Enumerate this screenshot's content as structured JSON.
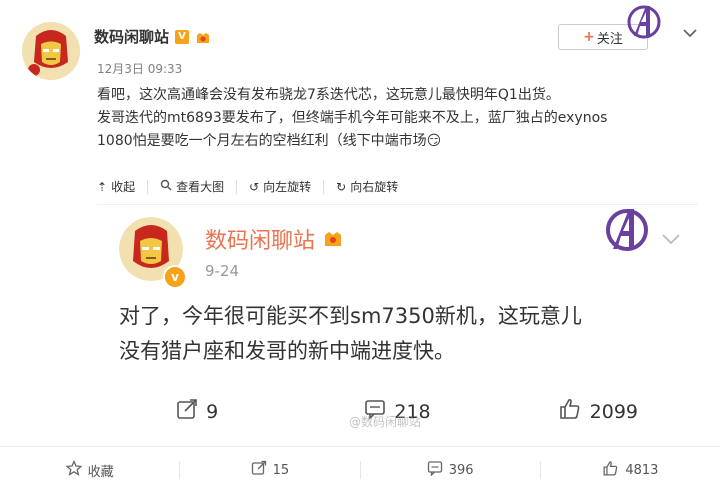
{
  "post": {
    "author": "数码闲聊站",
    "verified_badge": "V",
    "time": "12月3日 09:33",
    "follow_label": "关注",
    "lines": [
      "看吧，这次高通峰会没有发布骁龙7系迭代芯，这玩意儿最快明年Q1出货。",
      "发哥迭代的mt6893要发布了，但终端手机今年可能来不及上，蓝厂独占的exynos",
      "1080怕是要吃一个月左右的空档红利（线下中端市场😏"
    ],
    "toolbar": {
      "collapse": "收起",
      "view_large": "查看大图",
      "rotate_left": "向左旋转",
      "rotate_right": "向右旋转"
    }
  },
  "quoted": {
    "author": "数码闲聊站",
    "date": "9-24",
    "lines": [
      "对了，今年很可能买不到sm7350新机，这玩意儿",
      "没有猎户座和发哥的新中端进度快。"
    ],
    "repost_count": "9",
    "comment_count": "218",
    "like_count": "2099",
    "watermark": "@数码闲聊站"
  },
  "footer": {
    "favorite_label": "收藏",
    "repost_count": "15",
    "comment_count": "396",
    "like_count": "4813"
  },
  "colors": {
    "accent": "#eb7350",
    "badge": "#f7a21a",
    "avenger": "#6a3fa0"
  },
  "icons": [
    "ironman-avatar",
    "avengers-logo",
    "chevron-down-icon",
    "repost-icon",
    "comment-icon",
    "like-icon",
    "star-icon"
  ]
}
